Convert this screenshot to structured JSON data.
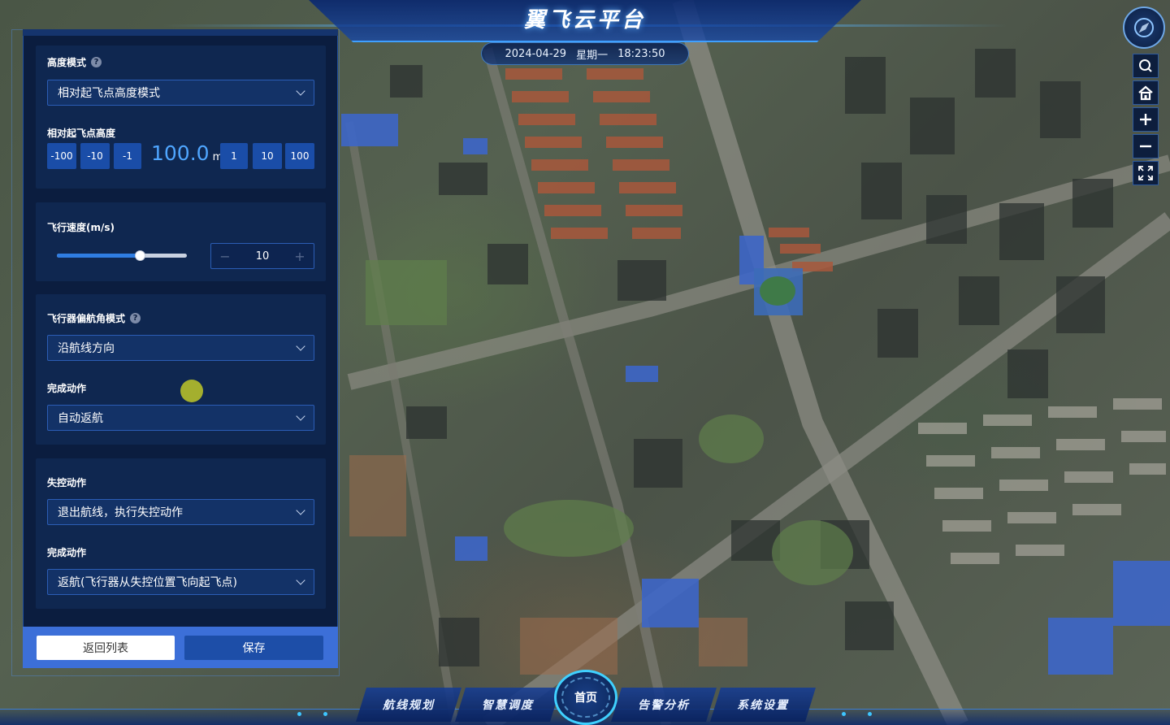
{
  "header": {
    "title": "翼飞云平台",
    "date": "2024-04-29",
    "weekday": "星期一",
    "time": "18:23:50"
  },
  "panel": {
    "altitude_mode": {
      "label": "高度模式",
      "value": "相对起飞点高度模式"
    },
    "relative_height": {
      "label": "相对起飞点高度",
      "minus_buttons": [
        "-100",
        "-10",
        "-1"
      ],
      "plus_buttons": [
        "1",
        "10",
        "100"
      ],
      "value": "100.0",
      "unit": "m"
    },
    "speed": {
      "label": "飞行速度(m/s)",
      "value": "10",
      "slider_fraction": 0.64,
      "minus": "−",
      "plus": "+"
    },
    "yaw_mode": {
      "label": "飞行器偏航角模式",
      "value": "沿航线方向"
    },
    "finish_action": {
      "label": "完成动作",
      "value": "自动返航"
    },
    "lost_control": {
      "label": "失控动作",
      "value": "退出航线，执行失控动作"
    },
    "lost_finish_action": {
      "label": "完成动作",
      "value": "返航(飞行器从失控位置飞向起飞点)"
    },
    "buttons": {
      "back": "返回列表",
      "save": "保存"
    }
  },
  "toolbar": {
    "icons": [
      "compass-icon",
      "search-icon",
      "home-icon",
      "zoom-in-icon",
      "zoom-out-icon",
      "fullscreen-icon"
    ]
  },
  "nav": {
    "items": [
      "航线规划",
      "智慧调度",
      "告警分析",
      "系统设置"
    ],
    "home": "首页"
  },
  "colors": {
    "panel_bg": "#0b1d3f",
    "card_bg": "#0f2750",
    "accent": "#1a4da8",
    "value_blue": "#4fa6ff",
    "footer": "#3c6fd8"
  }
}
